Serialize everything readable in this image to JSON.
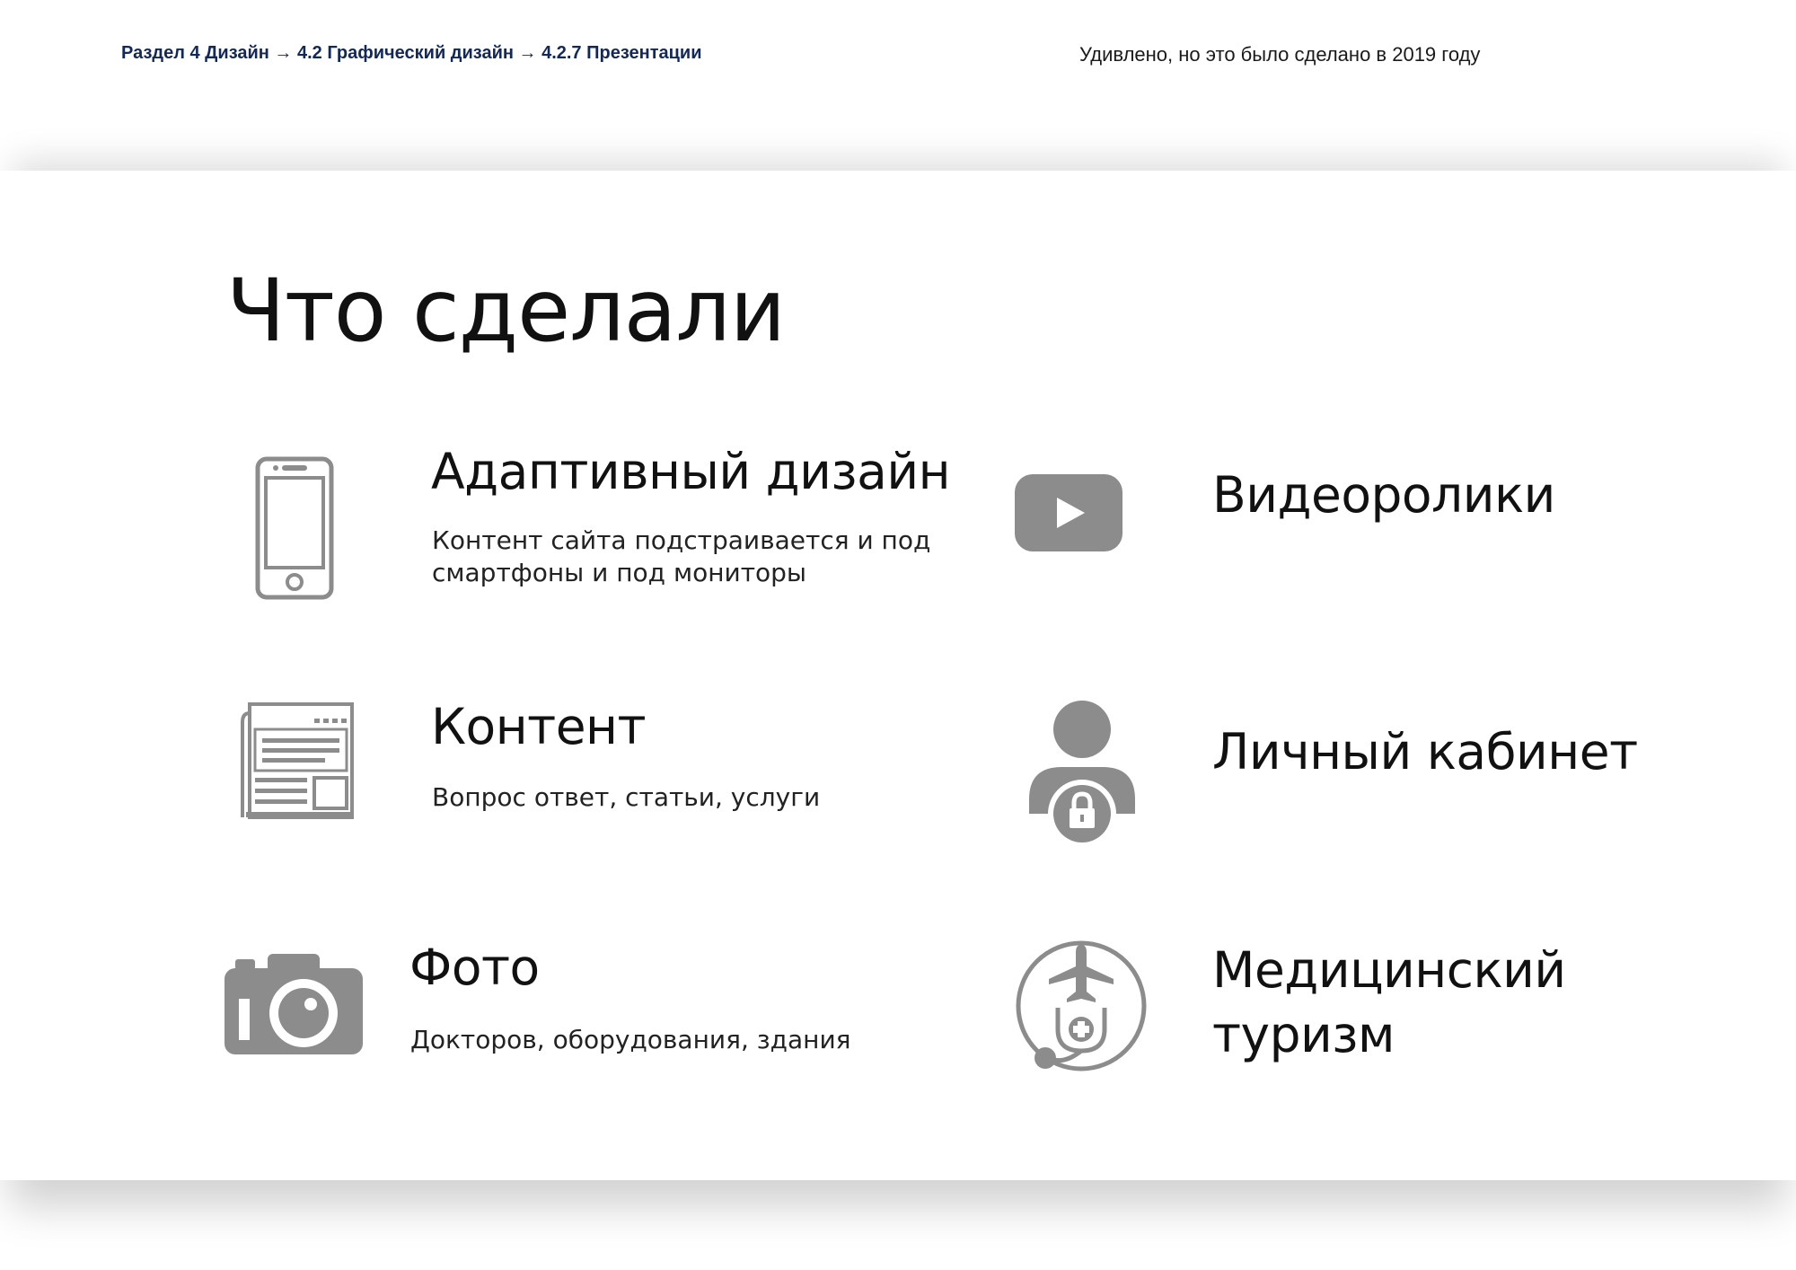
{
  "header": {
    "breadcrumb": "Раздел 4 Дизайн  → 4.2 Графический дизайн → 4.2.7 Презентации",
    "note": "Удивлено, но это было сделано в 2019 году"
  },
  "slide": {
    "title": "Что сделали",
    "items": [
      {
        "icon": "smartphone-icon",
        "title": "Адаптивный дизайн",
        "description": "Контент сайта подстраивается и под смартфоны и под мониторы"
      },
      {
        "icon": "video-play-icon",
        "title": "Видеоролики"
      },
      {
        "icon": "newspaper-icon",
        "title": "Контент",
        "description": "Вопрос ответ, статьи, услуги"
      },
      {
        "icon": "user-lock-icon",
        "title": "Личный кабинет"
      },
      {
        "icon": "camera-icon",
        "title": "Фото",
        "description": "Докторов, оборудования, здания"
      },
      {
        "icon": "medical-tourism-icon",
        "title": "Медицинский\nтуризм"
      }
    ]
  },
  "colors": {
    "breadcrumb": "#13285a",
    "icon_gray": "#8c8c8c",
    "text": "#111111"
  }
}
